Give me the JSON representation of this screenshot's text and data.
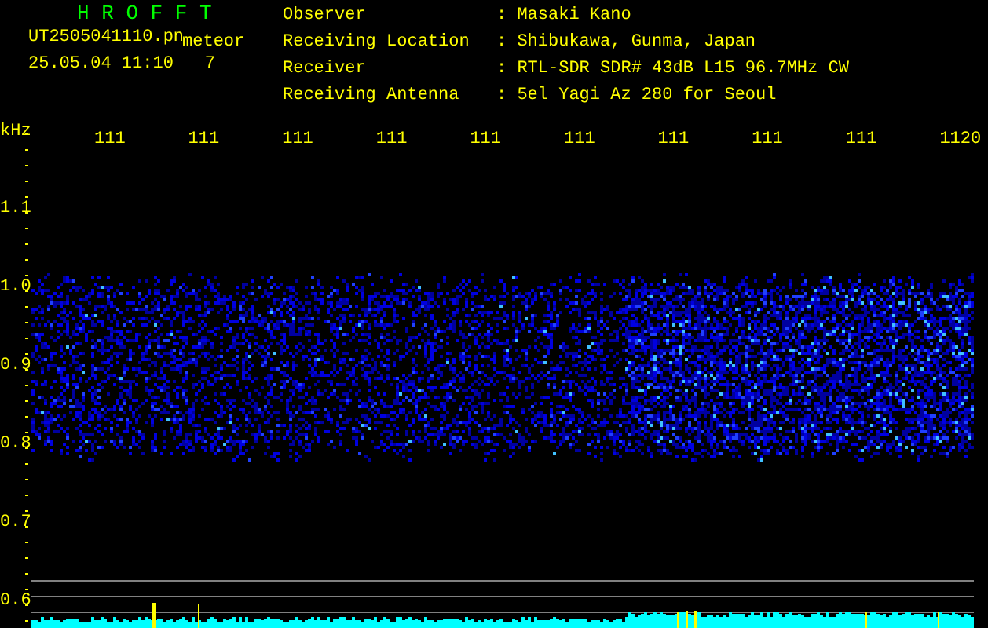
{
  "header": {
    "title": "H R O F F T",
    "file_name": "UT2505041110.pn",
    "file_suffix": "meteor",
    "timestamp": "25.05.04 11:10",
    "counter": "7"
  },
  "station_info": [
    {
      "label": "Observer",
      "value": ": Masaki Kano"
    },
    {
      "label": "Receiving Location",
      "value": ": Shibukawa, Gunma, Japan"
    },
    {
      "label": "Receiver",
      "value": ": RTL-SDR SDR# 43dB L15 96.7MHz CW"
    },
    {
      "label": "Receiving Antenna",
      "value": ": 5el Yagi Az 280 for Seoul"
    }
  ],
  "plot": {
    "y_unit": "kHz",
    "x_labels": [
      "111",
      "111",
      "111",
      "111",
      "111",
      "111",
      "111",
      "111",
      "111",
      "1120"
    ],
    "y_labels": [
      "1.1",
      "1.0",
      "0.9",
      "0.8",
      "0.7",
      "0.6"
    ]
  }
}
